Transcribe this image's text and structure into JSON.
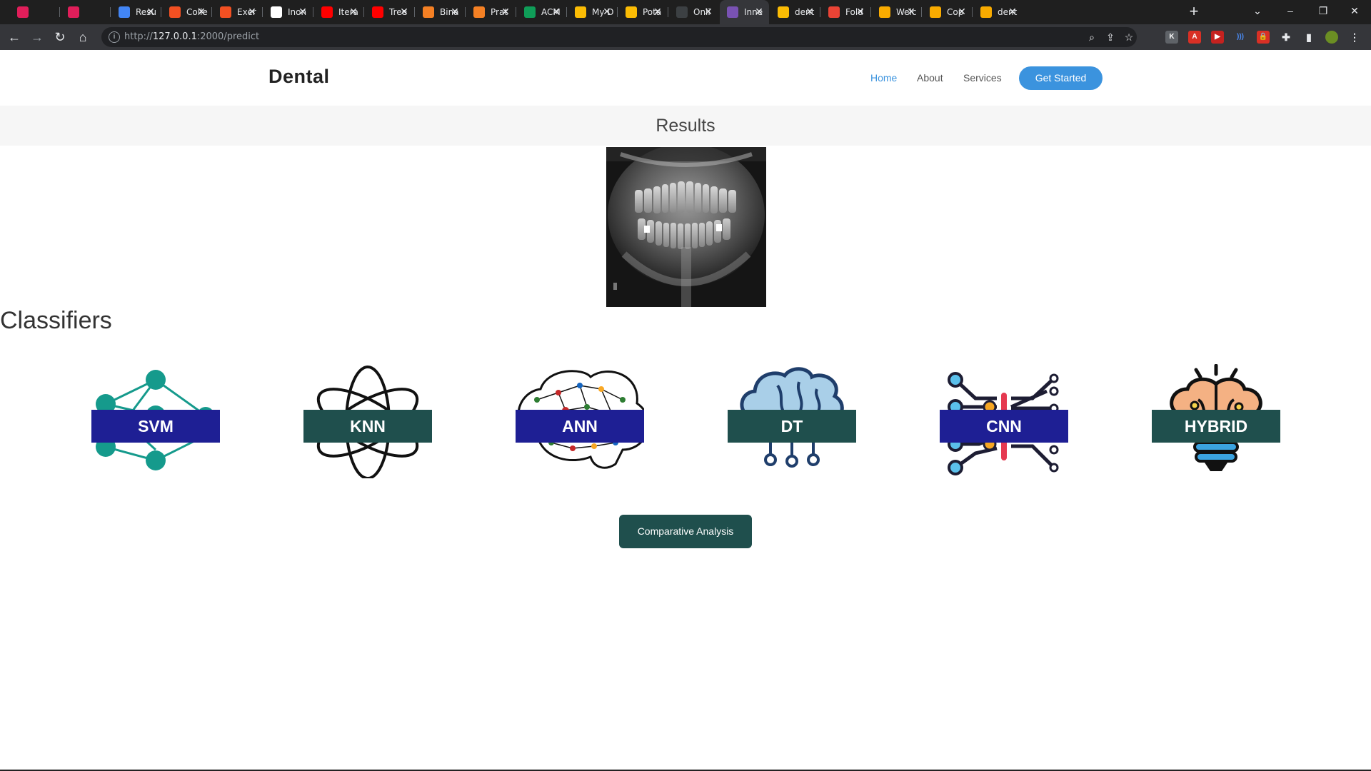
{
  "browser": {
    "tabs": [
      {
        "label": "",
        "icon": "slack-icon",
        "color": "#e01e5a"
      },
      {
        "label": "",
        "icon": "slack-icon",
        "color": "#e01e5a"
      },
      {
        "label": "Resu",
        "icon": "docs-icon",
        "color": "#4285f4"
      },
      {
        "label": "Colle",
        "icon": "microsoft-icon",
        "color": "#f25022"
      },
      {
        "label": "Exer",
        "icon": "microsoft-icon",
        "color": "#f25022"
      },
      {
        "label": "Inon",
        "icon": "google-icon",
        "color": "#ffffff"
      },
      {
        "label": "Itera",
        "icon": "youtube-icon",
        "color": "#ff0000"
      },
      {
        "label": "Tree",
        "icon": "youtube-icon",
        "color": "#ff0000"
      },
      {
        "label": "Bina",
        "icon": "stackoverflow-icon",
        "color": "#f48024"
      },
      {
        "label": "Prat",
        "icon": "stackoverflow-icon",
        "color": "#f48024"
      },
      {
        "label": "ACM",
        "icon": "sheets-plus-icon",
        "color": "#0f9d58"
      },
      {
        "label": "My D",
        "icon": "drive-icon",
        "color": "#fbbc04"
      },
      {
        "label": "Pota",
        "icon": "drive-icon",
        "color": "#fbbc04"
      },
      {
        "label": "Onli",
        "icon": "d-letter-icon",
        "color": "#3c4043"
      },
      {
        "label": "Inne",
        "icon": "bootstrap-icon",
        "color": "#7952b3",
        "active": true
      },
      {
        "label": "dent",
        "icon": "drive-icon",
        "color": "#fbbc04"
      },
      {
        "label": "Fold",
        "icon": "gmail-icon",
        "color": "#ea4335"
      },
      {
        "label": "Welc",
        "icon": "colab-icon",
        "color": "#f9ab00"
      },
      {
        "label": "Cop",
        "icon": "colab-icon",
        "color": "#f9ab00"
      },
      {
        "label": "dent",
        "icon": "colab-icon",
        "color": "#f9ab00"
      }
    ],
    "url_scheme": "http://",
    "url_host": "127.0.0.1",
    "url_path": ":2000/predict"
  },
  "site": {
    "brand": "Dental",
    "nav": {
      "home": "Home",
      "about": "About",
      "services": "Services",
      "cta": "Get Started"
    },
    "results_title": "Results",
    "section_title": "Classifiers",
    "classifiers": [
      {
        "label": "SVM",
        "icon": "neural-network-icon",
        "style": "blue"
      },
      {
        "label": "KNN",
        "icon": "atom-icon",
        "style": "teal"
      },
      {
        "label": "ANN",
        "icon": "brain-network-icon",
        "style": "blue"
      },
      {
        "label": "DT",
        "icon": "brain-circuit-icon",
        "style": "teal"
      },
      {
        "label": "CNN",
        "icon": "circuit-icon",
        "style": "blue"
      },
      {
        "label": "HYBRID",
        "icon": "brain-bulb-icon",
        "style": "teal"
      }
    ],
    "analysis_button": "Comparative Analysis"
  }
}
